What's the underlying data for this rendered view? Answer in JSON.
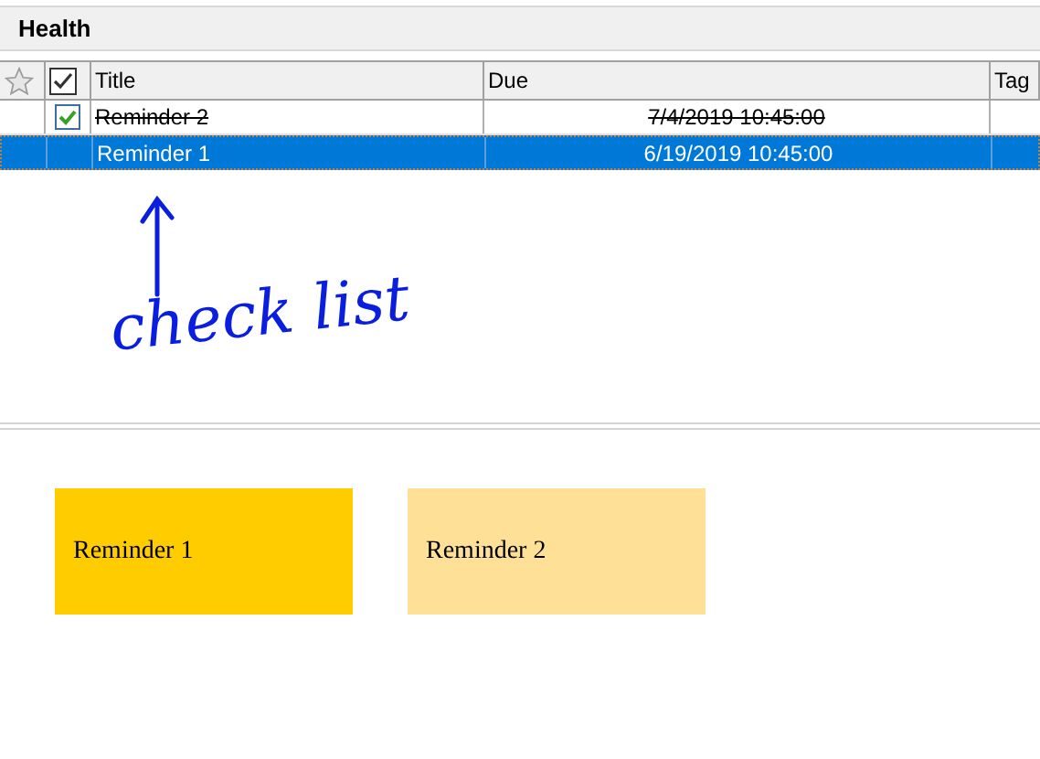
{
  "section": {
    "title": "Health"
  },
  "table": {
    "columns": [
      {
        "kind": "star"
      },
      {
        "kind": "check"
      },
      {
        "kind": "text",
        "label": "Title"
      },
      {
        "kind": "text",
        "label": "Due"
      },
      {
        "kind": "text",
        "label": "Tag"
      }
    ],
    "rows": [
      {
        "title": "Reminder 2",
        "due": "7/4/2019 10:45:00",
        "completed": true,
        "selected": false
      },
      {
        "title": "Reminder 1",
        "due": "6/19/2019 10:45:00",
        "completed": false,
        "selected": true
      }
    ]
  },
  "annotation": {
    "text": "check list"
  },
  "cards": [
    {
      "title": "Reminder 1",
      "color": "#ffcc00"
    },
    {
      "title": "Reminder 2",
      "color": "#fee096"
    }
  ]
}
